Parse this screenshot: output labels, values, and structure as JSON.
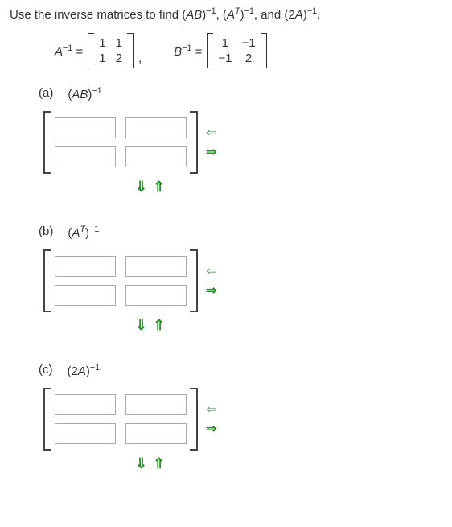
{
  "intro": {
    "prefix": "Use the inverse matrices to find (",
    "ab": "AB",
    "close_inv": ")",
    "sup_inv": "−1",
    "comma1": ", (",
    "at": "A",
    "T": "T",
    "close2": ")",
    "comma2": ", and (2",
    "a2": "A",
    "close3": ")",
    "period": "."
  },
  "matrixA": {
    "label_A": "A",
    "sup": "−1",
    "eq": " = ",
    "cells": {
      "r1c1": "1",
      "r1c2": "1",
      "r2c1": "1",
      "r2c2": "2"
    }
  },
  "matrixB": {
    "label_B": "B",
    "sup": "−1",
    "eq": " = ",
    "cells": {
      "r1c1": "1",
      "r1c2": "−1",
      "r2c1": "−1",
      "r2c2": "2"
    }
  },
  "parts": {
    "a": {
      "tag": "(a)",
      "expr_open": "(",
      "expr_inner": "AB",
      "expr_close": ")",
      "sup": "−1"
    },
    "b": {
      "tag": "(b)",
      "expr_open": "(",
      "expr_A": "A",
      "expr_T": "T",
      "expr_close": ")",
      "sup": "−1"
    },
    "c": {
      "tag": "(c)",
      "expr_open": "(2",
      "expr_A": "A",
      "expr_close": ")",
      "sup": "−1"
    }
  },
  "icons": {
    "arrow_left": "⇐",
    "arrow_right": "⇒",
    "arrow_down": "⇓",
    "arrow_up": "⇑"
  }
}
